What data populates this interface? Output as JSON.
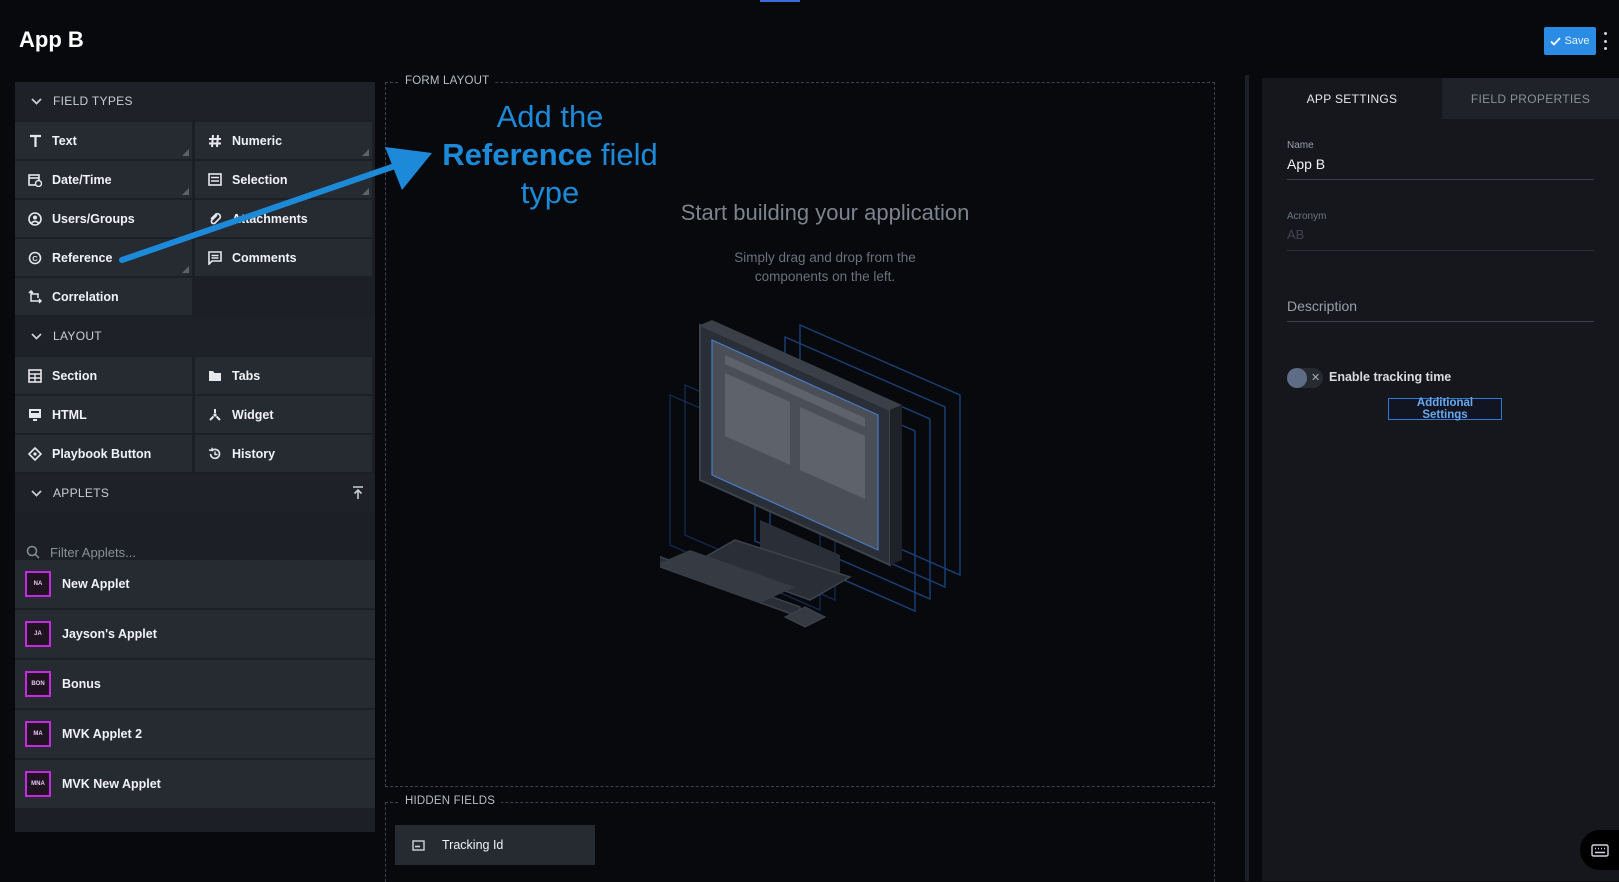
{
  "app": {
    "title": "App B",
    "save_label": "Save"
  },
  "left": {
    "field_types": {
      "header": "FIELD TYPES",
      "items": [
        {
          "label": "Text",
          "icon": "text-icon"
        },
        {
          "label": "Numeric",
          "icon": "hash-icon"
        },
        {
          "label": "Date/Time",
          "icon": "calendar-clock-icon"
        },
        {
          "label": "Selection",
          "icon": "list-icon"
        },
        {
          "label": "Users/Groups",
          "icon": "user-circle-icon"
        },
        {
          "label": "Attachments",
          "icon": "paperclip-icon"
        },
        {
          "label": "Reference",
          "icon": "reference-icon"
        },
        {
          "label": "Comments",
          "icon": "comment-icon"
        },
        {
          "label": "Correlation",
          "icon": "correlation-icon"
        }
      ]
    },
    "layout": {
      "header": "LAYOUT",
      "items": [
        {
          "label": "Section",
          "icon": "grid-icon"
        },
        {
          "label": "Tabs",
          "icon": "folder-icon"
        },
        {
          "label": "HTML",
          "icon": "monitor-icon"
        },
        {
          "label": "Widget",
          "icon": "widget-icon"
        },
        {
          "label": "Playbook Button",
          "icon": "diamond-icon"
        },
        {
          "label": "History",
          "icon": "history-icon"
        }
      ]
    },
    "applets": {
      "header": "APPLETS",
      "filter_placeholder": "Filter Applets...",
      "items": [
        {
          "badge": "NA",
          "label": "New Applet"
        },
        {
          "badge": "JA",
          "label": "Jayson's Applet"
        },
        {
          "badge": "BON",
          "label": "Bonus"
        },
        {
          "badge": "MA",
          "label": "MVK Applet 2"
        },
        {
          "badge": "MNA",
          "label": "MVK New Applet"
        }
      ]
    }
  },
  "center": {
    "form_layout_label": "FORM LAYOUT",
    "annotation": {
      "line1": "Add the",
      "bold": "Reference",
      "line2_rest": "field",
      "line3": "type"
    },
    "empty_title": "Start building your application",
    "empty_sub_line1": "Simply drag and drop from the",
    "empty_sub_line2": "components on the left.",
    "hidden_fields_label": "HIDDEN FIELDS",
    "hidden_fields": [
      {
        "label": "Tracking Id"
      }
    ]
  },
  "right": {
    "tabs": [
      {
        "label": "APP SETTINGS"
      },
      {
        "label": "FIELD PROPERTIES"
      }
    ],
    "name_label": "Name",
    "name_value": "App B",
    "acronym_label": "Acronym",
    "acronym_placeholder": "AB",
    "description_label": "Description",
    "toggle_label": "Enable tracking time",
    "toggle_on": false,
    "additional_settings_label": "Additional Settings"
  },
  "colors": {
    "accent": "#2b8ce6",
    "annotation": "#1c8ad8",
    "applet_badge": "#c42be0"
  }
}
